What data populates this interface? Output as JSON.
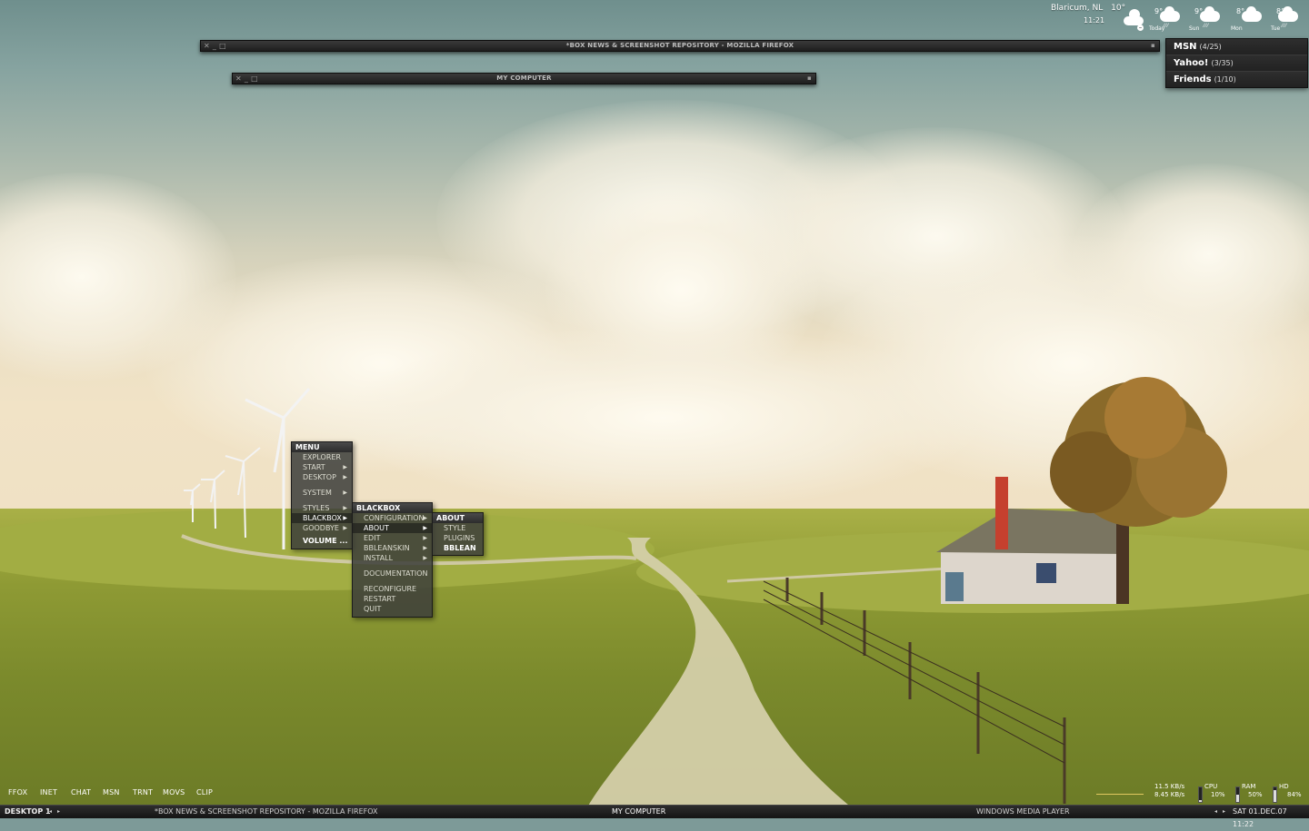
{
  "weather": {
    "location": "Blaricum, NL",
    "current_temp": "10°",
    "time": "11:21",
    "forecast": [
      {
        "temp": "9°",
        "day": "Today"
      },
      {
        "temp": "9°",
        "day": "Sun"
      },
      {
        "temp": "8°",
        "day": "Mon"
      },
      {
        "temp": "8°",
        "day": "Tue"
      }
    ]
  },
  "windows": {
    "firefox_title": "*BOX NEWS & SCREENSHOT REPOSITORY - MOZILLA FIREFOX",
    "mycomputer_title": "MY COMPUTER"
  },
  "im_panel": [
    {
      "name": "MSN",
      "count": "(4/25)"
    },
    {
      "name": "Yahoo!",
      "count": "(3/35)"
    },
    {
      "name": "Friends",
      "count": "(1/10)"
    }
  ],
  "menu": {
    "title": "MENU",
    "items": [
      "EXPLORER",
      "START",
      "DESKTOP",
      "SYSTEM",
      "STYLES",
      "BLACKBOX",
      "GOODBYE",
      "VOLUME ..."
    ]
  },
  "blackbox_menu": {
    "title": "BLACKBOX",
    "items": [
      "CONFIGURATION",
      "ABOUT",
      "EDIT",
      "BBLEANSKIN",
      "INSTALL",
      "DOCUMENTATION",
      "RECONFIGURE",
      "RESTART",
      "QUIT"
    ]
  },
  "about_menu": {
    "title": "ABOUT",
    "items": [
      "STYLE",
      "PLUGINS",
      "BBLEAN"
    ]
  },
  "quicklaunch": [
    "FFOX",
    "INET",
    "CHAT",
    "MSN",
    "TRNT",
    "MOVS",
    "CLIP"
  ],
  "taskbar": {
    "desktop": "DESKTOP 1",
    "tasks": [
      "*BOX NEWS & SCREENSHOT REPOSITORY - MOZILLA FIREFOX",
      "MY COMPUTER",
      "WINDOWS MEDIA PLAYER"
    ],
    "clock": "SAT 01.DEC.07 11:22"
  },
  "system": {
    "net_down": "11.5 KB/s",
    "net_up": "8.45 KB/s",
    "cpu_label": "CPU",
    "cpu_value": "10%",
    "cpu_level": 0.1,
    "ram_label": "RAM",
    "ram_value": "50%",
    "ram_level": 0.5,
    "hd_label": "HD",
    "hd_value": "84%",
    "hd_level": 0.84
  }
}
